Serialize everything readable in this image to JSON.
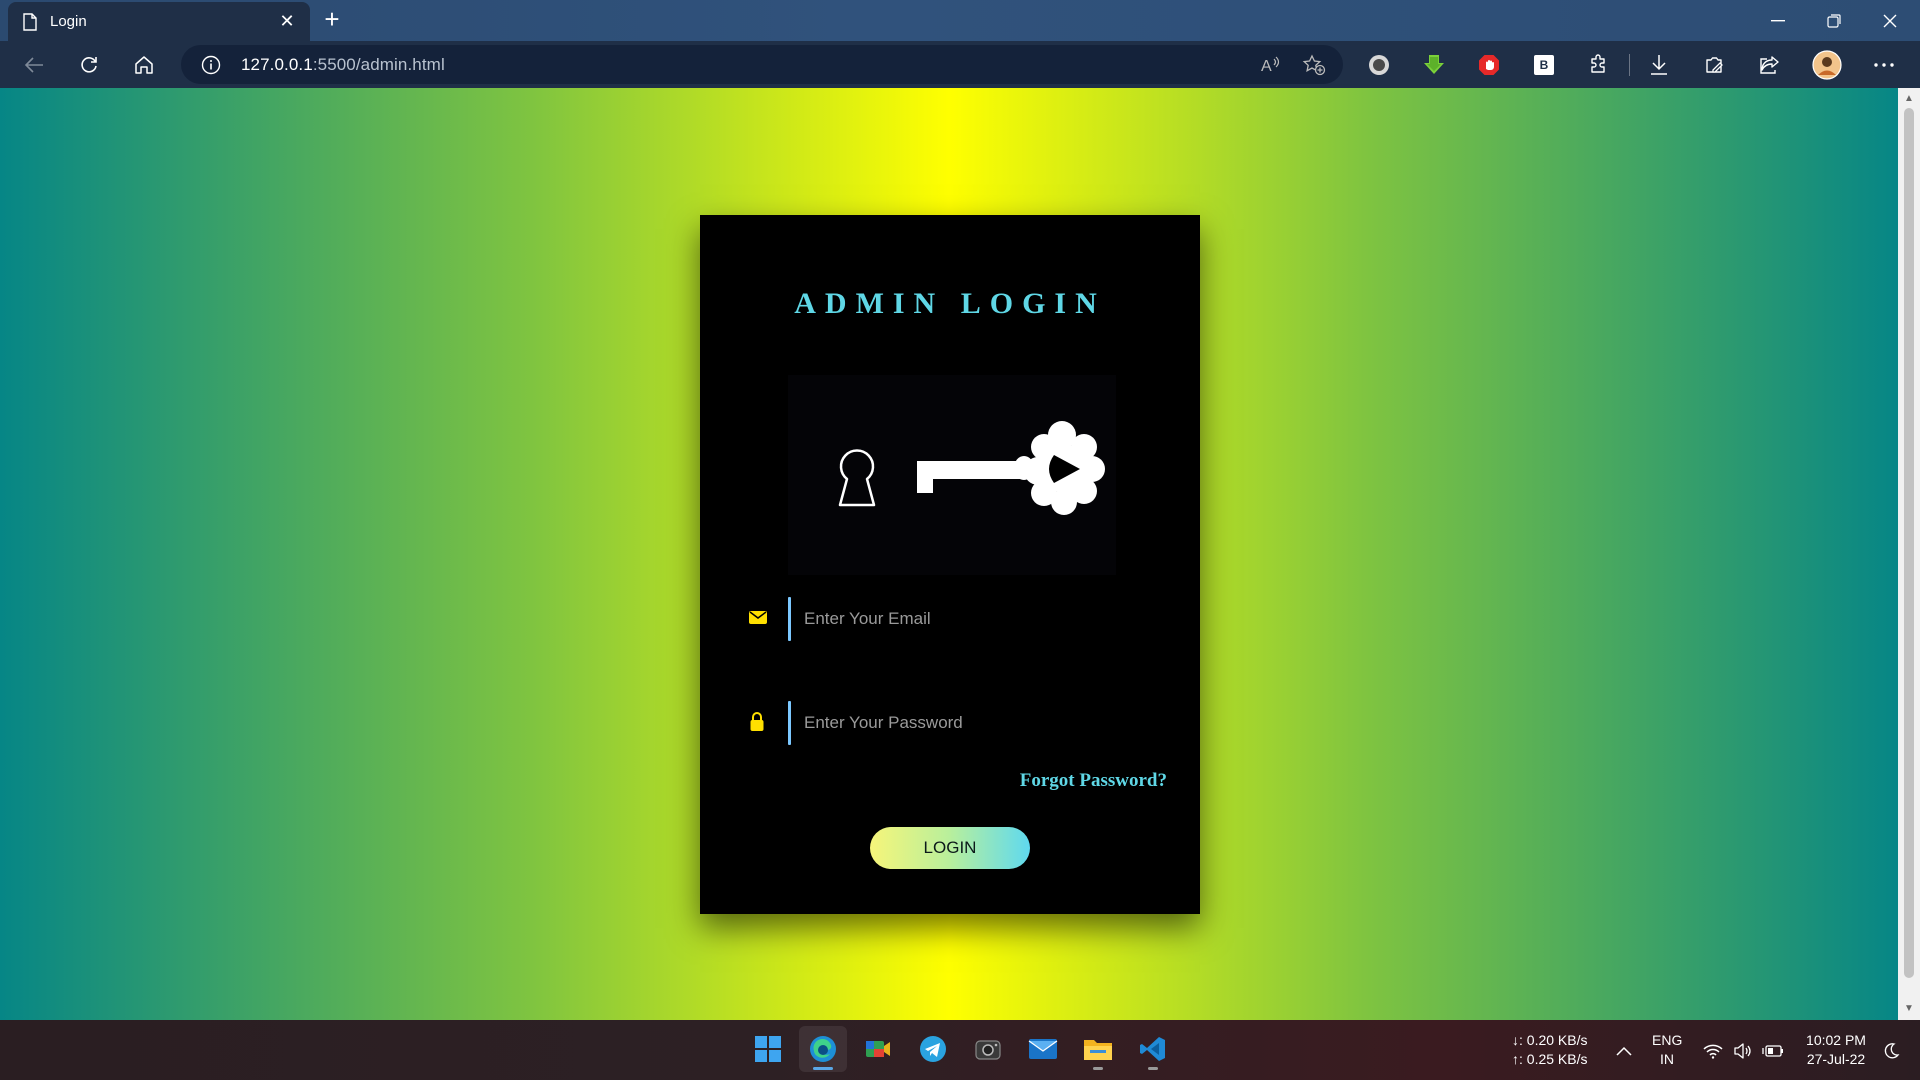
{
  "browser": {
    "tab": {
      "title": "Login"
    },
    "address_bar": {
      "host": "127.0.0.1",
      "rest": ":5500/admin.html"
    }
  },
  "page": {
    "title": "ADMIN LOGIN",
    "email": {
      "placeholder": "Enter Your Email",
      "value": ""
    },
    "password": {
      "placeholder": "Enter Your Password",
      "value": ""
    },
    "forgot_label": "Forgot Password?",
    "login_label": "LOGIN",
    "extension_badge": "B"
  },
  "taskbar": {
    "net_down": "↓: 0.20 KB/s",
    "net_up": "↑: 0.25 KB/s",
    "lang_1": "ENG",
    "lang_2": "IN",
    "time": "10:02 PM",
    "date": "27-Jul-22"
  },
  "colors": {
    "card_bg": "#000000",
    "accent_cyan": "#5fd7e6",
    "icon_yellow": "#ffe000",
    "page_gradient": [
      "#068686",
      "#7fc440",
      "#ffff00"
    ]
  }
}
